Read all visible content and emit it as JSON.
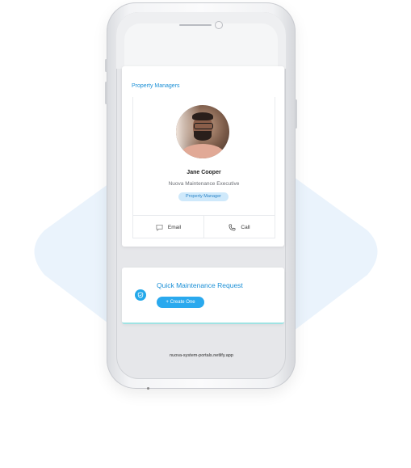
{
  "section": {
    "title": "Property Managers"
  },
  "manager": {
    "name": "Jane Cooper",
    "role": "Nuova Maintenance Executive",
    "badge": "Property Manager",
    "actions": {
      "email": "Email",
      "call": "Call"
    }
  },
  "quick": {
    "title": "Quick Maintenance Request",
    "button": "+ Create One"
  },
  "browser": {
    "url": "nuova-system-portals.netlify.app"
  },
  "colors": {
    "accent": "#1a8fd6",
    "button": "#2aa9ee",
    "badge_bg": "#cfe9fb",
    "bg_shape": "#eaf3fc"
  }
}
